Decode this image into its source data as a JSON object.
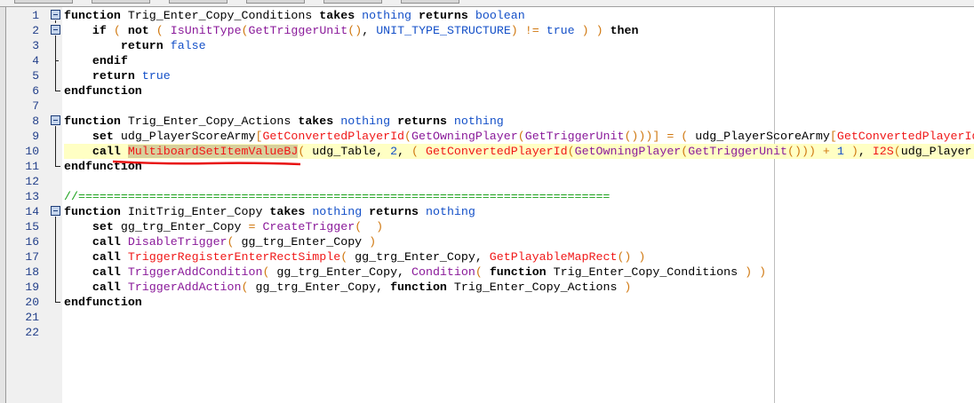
{
  "editor": {
    "colors": {
      "keyword": "#000000",
      "type": "#1450c8",
      "native": "#8a1a9a",
      "bj": "#f01818",
      "paren": "#d07810",
      "comment": "#18a018",
      "current_line": "#ffffc4"
    },
    "current_line": 10,
    "lines": [
      {
        "n": "1",
        "fold": "start",
        "tokens": [
          [
            "kw",
            "function"
          ],
          [
            "id",
            " Trig_Enter_Copy_Conditions "
          ],
          [
            "kw",
            "takes"
          ],
          [
            "id",
            " "
          ],
          [
            "type",
            "nothing"
          ],
          [
            "id",
            " "
          ],
          [
            "kw",
            "returns"
          ],
          [
            "id",
            " "
          ],
          [
            "type",
            "boolean"
          ]
        ]
      },
      {
        "n": "2",
        "fold": "start",
        "tokens": [
          [
            "id",
            "    "
          ],
          [
            "kw",
            "if"
          ],
          [
            "id",
            " "
          ],
          [
            "paren",
            "("
          ],
          [
            "id",
            " "
          ],
          [
            "kw",
            "not"
          ],
          [
            "id",
            " "
          ],
          [
            "paren",
            "("
          ],
          [
            "id",
            " "
          ],
          [
            "native",
            "IsUnitType"
          ],
          [
            "paren",
            "("
          ],
          [
            "native",
            "GetTriggerUnit"
          ],
          [
            "paren",
            "()"
          ],
          [
            "id",
            ", "
          ],
          [
            "type",
            "UNIT_TYPE_STRUCTURE"
          ],
          [
            "paren",
            ")"
          ],
          [
            "id",
            " "
          ],
          [
            "paren",
            "!="
          ],
          [
            "id",
            " "
          ],
          [
            "type",
            "true"
          ],
          [
            "id",
            " "
          ],
          [
            "paren",
            ")"
          ],
          [
            "id",
            " "
          ],
          [
            "paren",
            ")"
          ],
          [
            "id",
            " "
          ],
          [
            "kw",
            "then"
          ]
        ]
      },
      {
        "n": "3",
        "fold": "mid",
        "tokens": [
          [
            "id",
            "        "
          ],
          [
            "kw",
            "return"
          ],
          [
            "id",
            " "
          ],
          [
            "type",
            "false"
          ]
        ]
      },
      {
        "n": "4",
        "fold": "end-inner",
        "tokens": [
          [
            "id",
            "    "
          ],
          [
            "kw",
            "endif"
          ]
        ]
      },
      {
        "n": "5",
        "fold": "mid",
        "tokens": [
          [
            "id",
            "    "
          ],
          [
            "kw",
            "return"
          ],
          [
            "id",
            " "
          ],
          [
            "type",
            "true"
          ]
        ]
      },
      {
        "n": "6",
        "fold": "end",
        "tokens": [
          [
            "kw",
            "endfunction"
          ]
        ]
      },
      {
        "n": "7",
        "fold": "",
        "tokens": []
      },
      {
        "n": "8",
        "fold": "start",
        "tokens": [
          [
            "kw",
            "function"
          ],
          [
            "id",
            " Trig_Enter_Copy_Actions "
          ],
          [
            "kw",
            "takes"
          ],
          [
            "id",
            " "
          ],
          [
            "type",
            "nothing"
          ],
          [
            "id",
            " "
          ],
          [
            "kw",
            "returns"
          ],
          [
            "id",
            " "
          ],
          [
            "type",
            "nothing"
          ]
        ]
      },
      {
        "n": "9",
        "fold": "mid",
        "tokens": [
          [
            "id",
            "    "
          ],
          [
            "kw",
            "set"
          ],
          [
            "id",
            " udg_PlayerScoreArmy"
          ],
          [
            "paren",
            "["
          ],
          [
            "bj",
            "GetConvertedPlayerId"
          ],
          [
            "paren",
            "("
          ],
          [
            "native",
            "GetOwningPlayer"
          ],
          [
            "paren",
            "("
          ],
          [
            "native",
            "GetTriggerUnit"
          ],
          [
            "paren",
            "()))]"
          ],
          [
            "id",
            " "
          ],
          [
            "paren",
            "="
          ],
          [
            "id",
            " "
          ],
          [
            "paren",
            "("
          ],
          [
            "id",
            " udg_PlayerScoreArmy"
          ],
          [
            "paren",
            "["
          ],
          [
            "bj",
            "GetConvertedPlayerId"
          ]
        ]
      },
      {
        "n": "10",
        "fold": "mid",
        "tokens": [
          [
            "id",
            "    "
          ],
          [
            "kw",
            "call"
          ],
          [
            "id",
            " "
          ],
          [
            "bj sel",
            "MultiboardSetItemValueBJ"
          ],
          [
            "paren",
            "("
          ],
          [
            "id",
            " udg_Table, "
          ],
          [
            "num",
            "2"
          ],
          [
            "id",
            ", "
          ],
          [
            "paren",
            "("
          ],
          [
            "id",
            " "
          ],
          [
            "bj",
            "GetConvertedPlayerId"
          ],
          [
            "paren",
            "("
          ],
          [
            "native",
            "GetOwningPlayer"
          ],
          [
            "paren",
            "("
          ],
          [
            "native",
            "GetTriggerUnit"
          ],
          [
            "paren",
            "()))"
          ],
          [
            "id",
            " "
          ],
          [
            "paren",
            "+"
          ],
          [
            "id",
            " "
          ],
          [
            "num",
            "1"
          ],
          [
            "id",
            " "
          ],
          [
            "paren",
            ")"
          ],
          [
            "id",
            ", "
          ],
          [
            "bj",
            "I2S"
          ],
          [
            "paren",
            "("
          ],
          [
            "id",
            "udg_Player"
          ]
        ]
      },
      {
        "n": "11",
        "fold": "end",
        "tokens": [
          [
            "kw",
            "endfunction"
          ]
        ]
      },
      {
        "n": "12",
        "fold": "",
        "tokens": []
      },
      {
        "n": "13",
        "fold": "",
        "tokens": [
          [
            "cmt",
            "//==========================================================================="
          ]
        ]
      },
      {
        "n": "14",
        "fold": "start",
        "tokens": [
          [
            "kw",
            "function"
          ],
          [
            "id",
            " InitTrig_Enter_Copy "
          ],
          [
            "kw",
            "takes"
          ],
          [
            "id",
            " "
          ],
          [
            "type",
            "nothing"
          ],
          [
            "id",
            " "
          ],
          [
            "kw",
            "returns"
          ],
          [
            "id",
            " "
          ],
          [
            "type",
            "nothing"
          ]
        ]
      },
      {
        "n": "15",
        "fold": "mid",
        "tokens": [
          [
            "id",
            "    "
          ],
          [
            "kw",
            "set"
          ],
          [
            "id",
            " gg_trg_Enter_Copy "
          ],
          [
            "paren",
            "="
          ],
          [
            "id",
            " "
          ],
          [
            "native",
            "CreateTrigger"
          ],
          [
            "paren",
            "("
          ],
          [
            "id",
            "  "
          ],
          [
            "paren",
            ")"
          ]
        ]
      },
      {
        "n": "16",
        "fold": "mid",
        "tokens": [
          [
            "id",
            "    "
          ],
          [
            "kw",
            "call"
          ],
          [
            "id",
            " "
          ],
          [
            "native",
            "DisableTrigger"
          ],
          [
            "paren",
            "("
          ],
          [
            "id",
            " gg_trg_Enter_Copy "
          ],
          [
            "paren",
            ")"
          ]
        ]
      },
      {
        "n": "17",
        "fold": "mid",
        "tokens": [
          [
            "id",
            "    "
          ],
          [
            "kw",
            "call"
          ],
          [
            "id",
            " "
          ],
          [
            "bj",
            "TriggerRegisterEnterRectSimple"
          ],
          [
            "paren",
            "("
          ],
          [
            "id",
            " gg_trg_Enter_Copy, "
          ],
          [
            "bj",
            "GetPlayableMapRect"
          ],
          [
            "paren",
            "()"
          ],
          [
            "id",
            " "
          ],
          [
            "paren",
            ")"
          ]
        ]
      },
      {
        "n": "18",
        "fold": "mid",
        "tokens": [
          [
            "id",
            "    "
          ],
          [
            "kw",
            "call"
          ],
          [
            "id",
            " "
          ],
          [
            "native",
            "TriggerAddCondition"
          ],
          [
            "paren",
            "("
          ],
          [
            "id",
            " gg_trg_Enter_Copy, "
          ],
          [
            "native",
            "Condition"
          ],
          [
            "paren",
            "("
          ],
          [
            "id",
            " "
          ],
          [
            "kw",
            "function"
          ],
          [
            "id",
            " Trig_Enter_Copy_Conditions "
          ],
          [
            "paren",
            ")"
          ],
          [
            "id",
            " "
          ],
          [
            "paren",
            ")"
          ]
        ]
      },
      {
        "n": "19",
        "fold": "mid",
        "tokens": [
          [
            "id",
            "    "
          ],
          [
            "kw",
            "call"
          ],
          [
            "id",
            " "
          ],
          [
            "native",
            "TriggerAddAction"
          ],
          [
            "paren",
            "("
          ],
          [
            "id",
            " gg_trg_Enter_Copy, "
          ],
          [
            "kw",
            "function"
          ],
          [
            "id",
            " Trig_Enter_Copy_Actions "
          ],
          [
            "paren",
            ")"
          ]
        ]
      },
      {
        "n": "20",
        "fold": "end",
        "tokens": [
          [
            "kw",
            "endfunction"
          ]
        ]
      },
      {
        "n": "21",
        "fold": "",
        "tokens": []
      },
      {
        "n": "22",
        "fold": "",
        "tokens": []
      }
    ]
  }
}
